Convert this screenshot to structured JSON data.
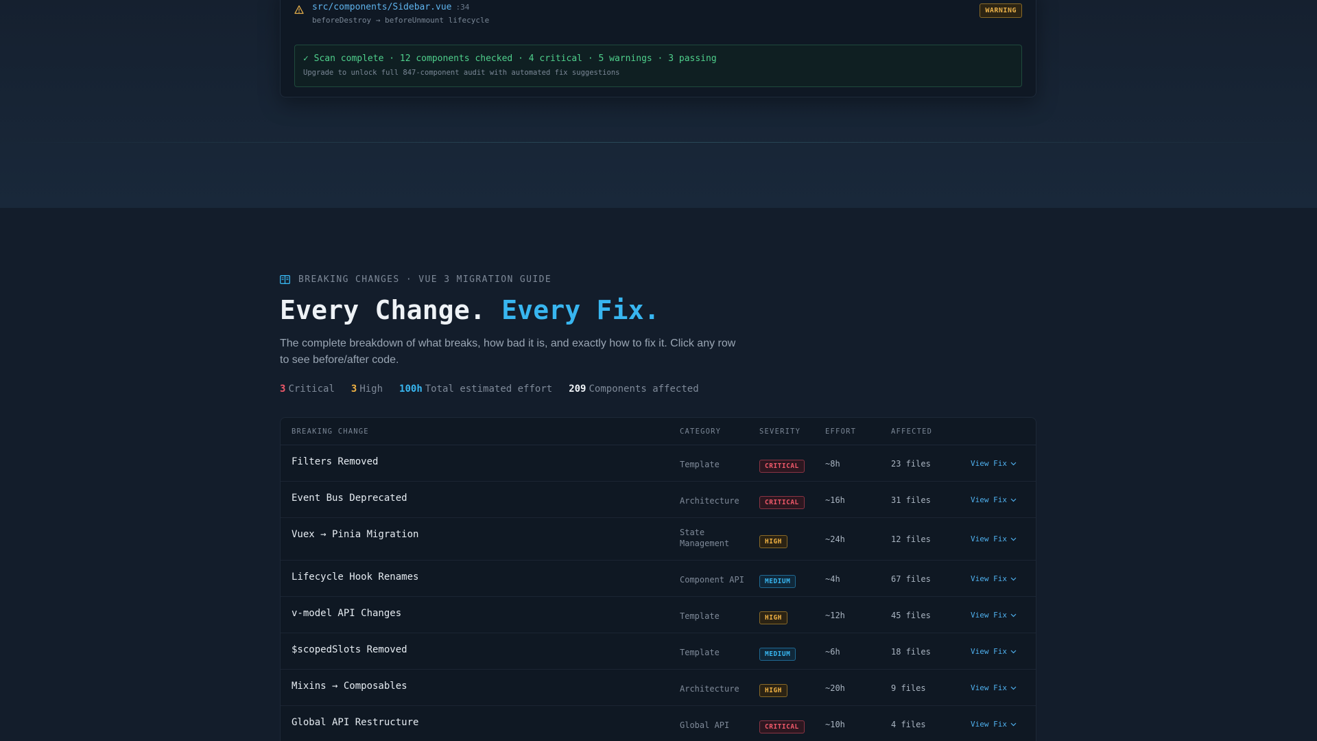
{
  "scan": {
    "file_path": "src/components/Sidebar.vue",
    "file_line": ":34",
    "file_desc": "beforeDestroy → beforeUnmount lifecycle",
    "badge": "WARNING",
    "summary_line": "✓ Scan complete · 12 components checked · 4 critical · 5 warnings · 3 passing",
    "summary_sub": "Upgrade to unlock full 847-component audit with automated fix suggestions"
  },
  "section": {
    "eyebrow": "BREAKING CHANGES · VUE 3 MIGRATION GUIDE",
    "headline_main": "Every Change.",
    "headline_accent": "Every Fix.",
    "lede": "The complete breakdown of what breaks, how bad it is, and exactly how to fix it. Click any row to see before/after code.",
    "stats": [
      {
        "value": "3",
        "label": "Critical",
        "color": "#f0596a"
      },
      {
        "value": "3",
        "label": "High",
        "color": "#f0b243"
      },
      {
        "value": "100h",
        "label": "Total estimated effort",
        "color": "#38b6f0"
      },
      {
        "value": "209",
        "label": "Components affected",
        "color": "#f1f5f9"
      }
    ]
  },
  "table": {
    "headers": {
      "name": "BREAKING CHANGE",
      "category": "CATEGORY",
      "severity": "SEVERITY",
      "effort": "EFFORT",
      "affected": "AFFECTED"
    },
    "action_label": "View Fix",
    "rows": [
      {
        "name": "Filters Removed",
        "category": "Template",
        "severity": "CRITICAL",
        "effort": "~8h",
        "affected": "23 files"
      },
      {
        "name": "Event Bus Deprecated",
        "category": "Architecture",
        "severity": "CRITICAL",
        "effort": "~16h",
        "affected": "31 files"
      },
      {
        "name": "Vuex → Pinia Migration",
        "category": "State Management",
        "category_lines": [
          "State",
          "Management"
        ],
        "severity": "HIGH",
        "effort": "~24h",
        "affected": "12 files"
      },
      {
        "name": "Lifecycle Hook Renames",
        "category": "Component API",
        "severity": "MEDIUM",
        "effort": "~4h",
        "affected": "67 files"
      },
      {
        "name": "v-model API Changes",
        "category": "Template",
        "severity": "HIGH",
        "effort": "~12h",
        "affected": "45 files"
      },
      {
        "name": "$scopedSlots Removed",
        "category": "Template",
        "severity": "MEDIUM",
        "effort": "~6h",
        "affected": "18 files"
      },
      {
        "name": "Mixins → Composables",
        "category": "Architecture",
        "severity": "HIGH",
        "effort": "~20h",
        "affected": "9 files"
      },
      {
        "name": "Global API Restructure",
        "category": "Global API",
        "severity": "CRITICAL",
        "effort": "~10h",
        "affected": "4 files"
      }
    ]
  },
  "icons": {
    "warning": "warning-triangle-icon",
    "book": "book-open-icon",
    "chevron": "chevron-down-icon"
  },
  "colors": {
    "critical": "#f0596a",
    "high": "#f0b243",
    "medium": "#38b6f0",
    "accent": "#38b6f0",
    "success": "#4fd08c"
  }
}
